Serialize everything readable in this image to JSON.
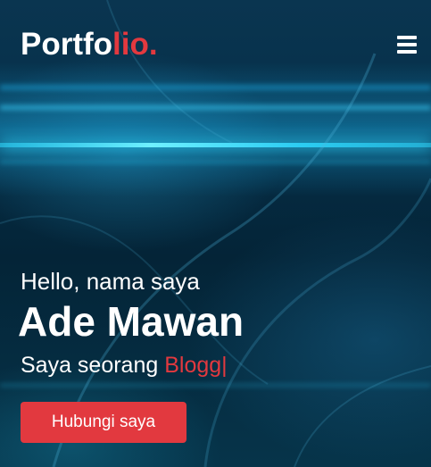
{
  "navbar": {
    "logo_main": "Portfo",
    "logo_accent": "lio.",
    "menu_icon": "hamburger-menu-icon"
  },
  "hero": {
    "greeting": "Hello, nama saya",
    "name": "Ade Mawan",
    "role_prefix": "Saya seorang ",
    "role_typed": "Blogg|",
    "cta_label": "Hubungi saya"
  },
  "colors": {
    "accent": "#e2393f",
    "text": "#ffffff",
    "background": "#063049",
    "light_streak": "#2fd9ff"
  }
}
